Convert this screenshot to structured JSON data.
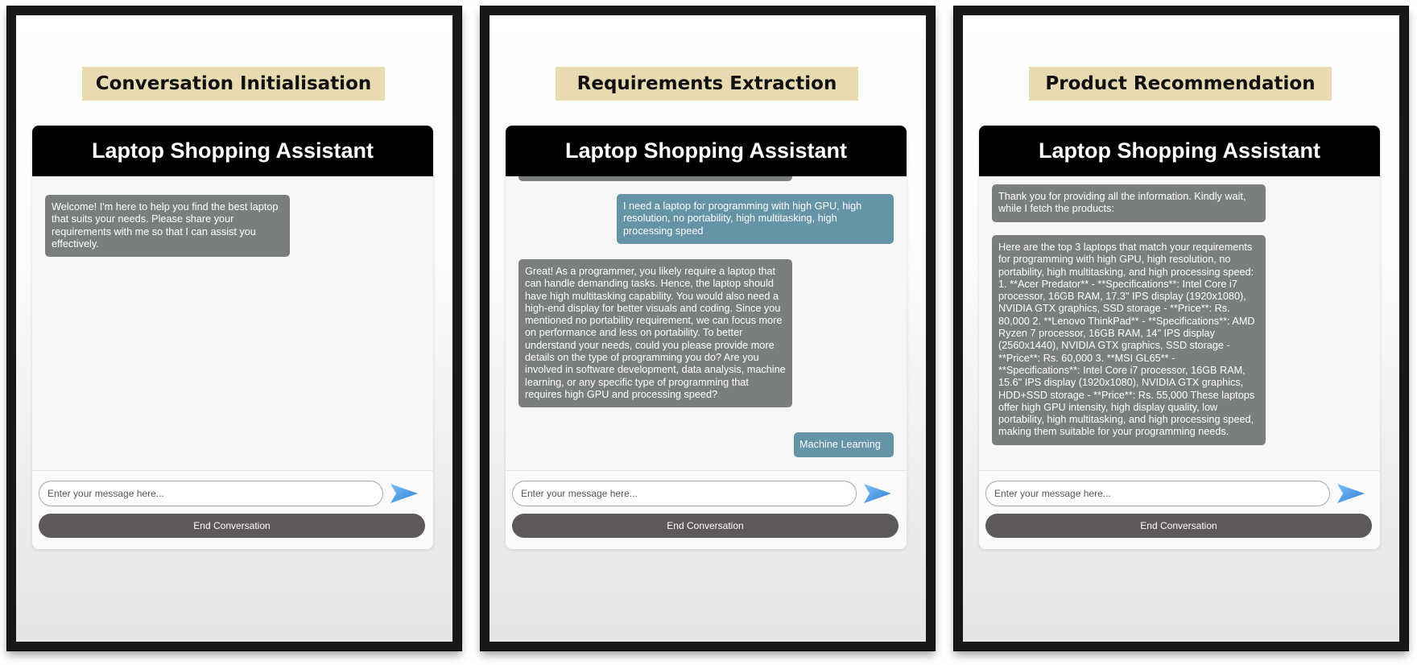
{
  "panels": [
    {
      "stage_title": "Conversation Initialisation",
      "app_title": "Laptop Shopping Assistant",
      "messages": [
        {
          "role": "bot",
          "text": "Welcome! I'm here to help you find the best laptop that suits your needs. Please share your requirements with me so that I can assist you effectively."
        }
      ],
      "input_placeholder": "Enter your message here...",
      "end_label": "End Conversation"
    },
    {
      "stage_title": "Requirements Extraction",
      "app_title": "Laptop Shopping Assistant",
      "messages": [
        {
          "role": "bot",
          "text": ""
        },
        {
          "role": "user",
          "text": "I need a laptop for programming with high GPU, high resolution, no portability, high multitasking, high processing speed"
        },
        {
          "role": "bot",
          "text": "Great! As a programmer, you likely require a laptop that can handle demanding tasks. Hence, the laptop should have high multitasking capability. You would also need a high-end display for better visuals and coding. Since you mentioned no portability requirement, we can focus more on performance and less on portability. To better understand your needs, could you please provide more details on the type of programming you do? Are you involved in software development, data analysis, machine learning, or any specific type of programming that requires high GPU and processing speed?"
        },
        {
          "role": "user",
          "text": "Machine Learning"
        }
      ],
      "input_placeholder": "Enter your message here...",
      "end_label": "End Conversation"
    },
    {
      "stage_title": "Product Recommendation",
      "app_title": "Laptop Shopping Assistant",
      "messages": [
        {
          "role": "bot",
          "text": "Thank you for providing all the information. Kindly wait, while I fetch the products:"
        },
        {
          "role": "bot",
          "text": "Here are the top 3 laptops that match your requirements for programming with high GPU, high resolution, no portability, high multitasking, and high processing speed: 1. **Acer Predator** - **Specifications**: Intel Core i7 processor, 16GB RAM, 17.3\" IPS display (1920x1080), NVIDIA GTX graphics, SSD storage - **Price**: Rs. 80,000 2. **Lenovo ThinkPad** - **Specifications**: AMD Ryzen 7 processor, 16GB RAM, 14\" IPS display (2560x1440), NVIDIA GTX graphics, SSD storage - **Price**: Rs. 60,000 3. **MSI GL65** - **Specifications**: Intel Core i7 processor, 16GB RAM, 15.6\" IPS display (1920x1080), NVIDIA GTX graphics, HDD+SSD storage - **Price**: Rs. 55,000 These laptops offer high GPU intensity, high display quality, low portability, high multitasking, and high processing speed, making them suitable for your programming needs."
        }
      ],
      "input_placeholder": "Enter your message here...",
      "end_label": "End Conversation"
    }
  ],
  "icons": {
    "send": "send-arrow-icon"
  },
  "colors": {
    "stage_title_bg": "#e8dbb2",
    "header_bg": "#000000",
    "bot_bubble": "#7b7f7c",
    "user_bubble": "#6494a6",
    "end_button": "#5c5958",
    "send_icon": "#4a9ae6"
  }
}
